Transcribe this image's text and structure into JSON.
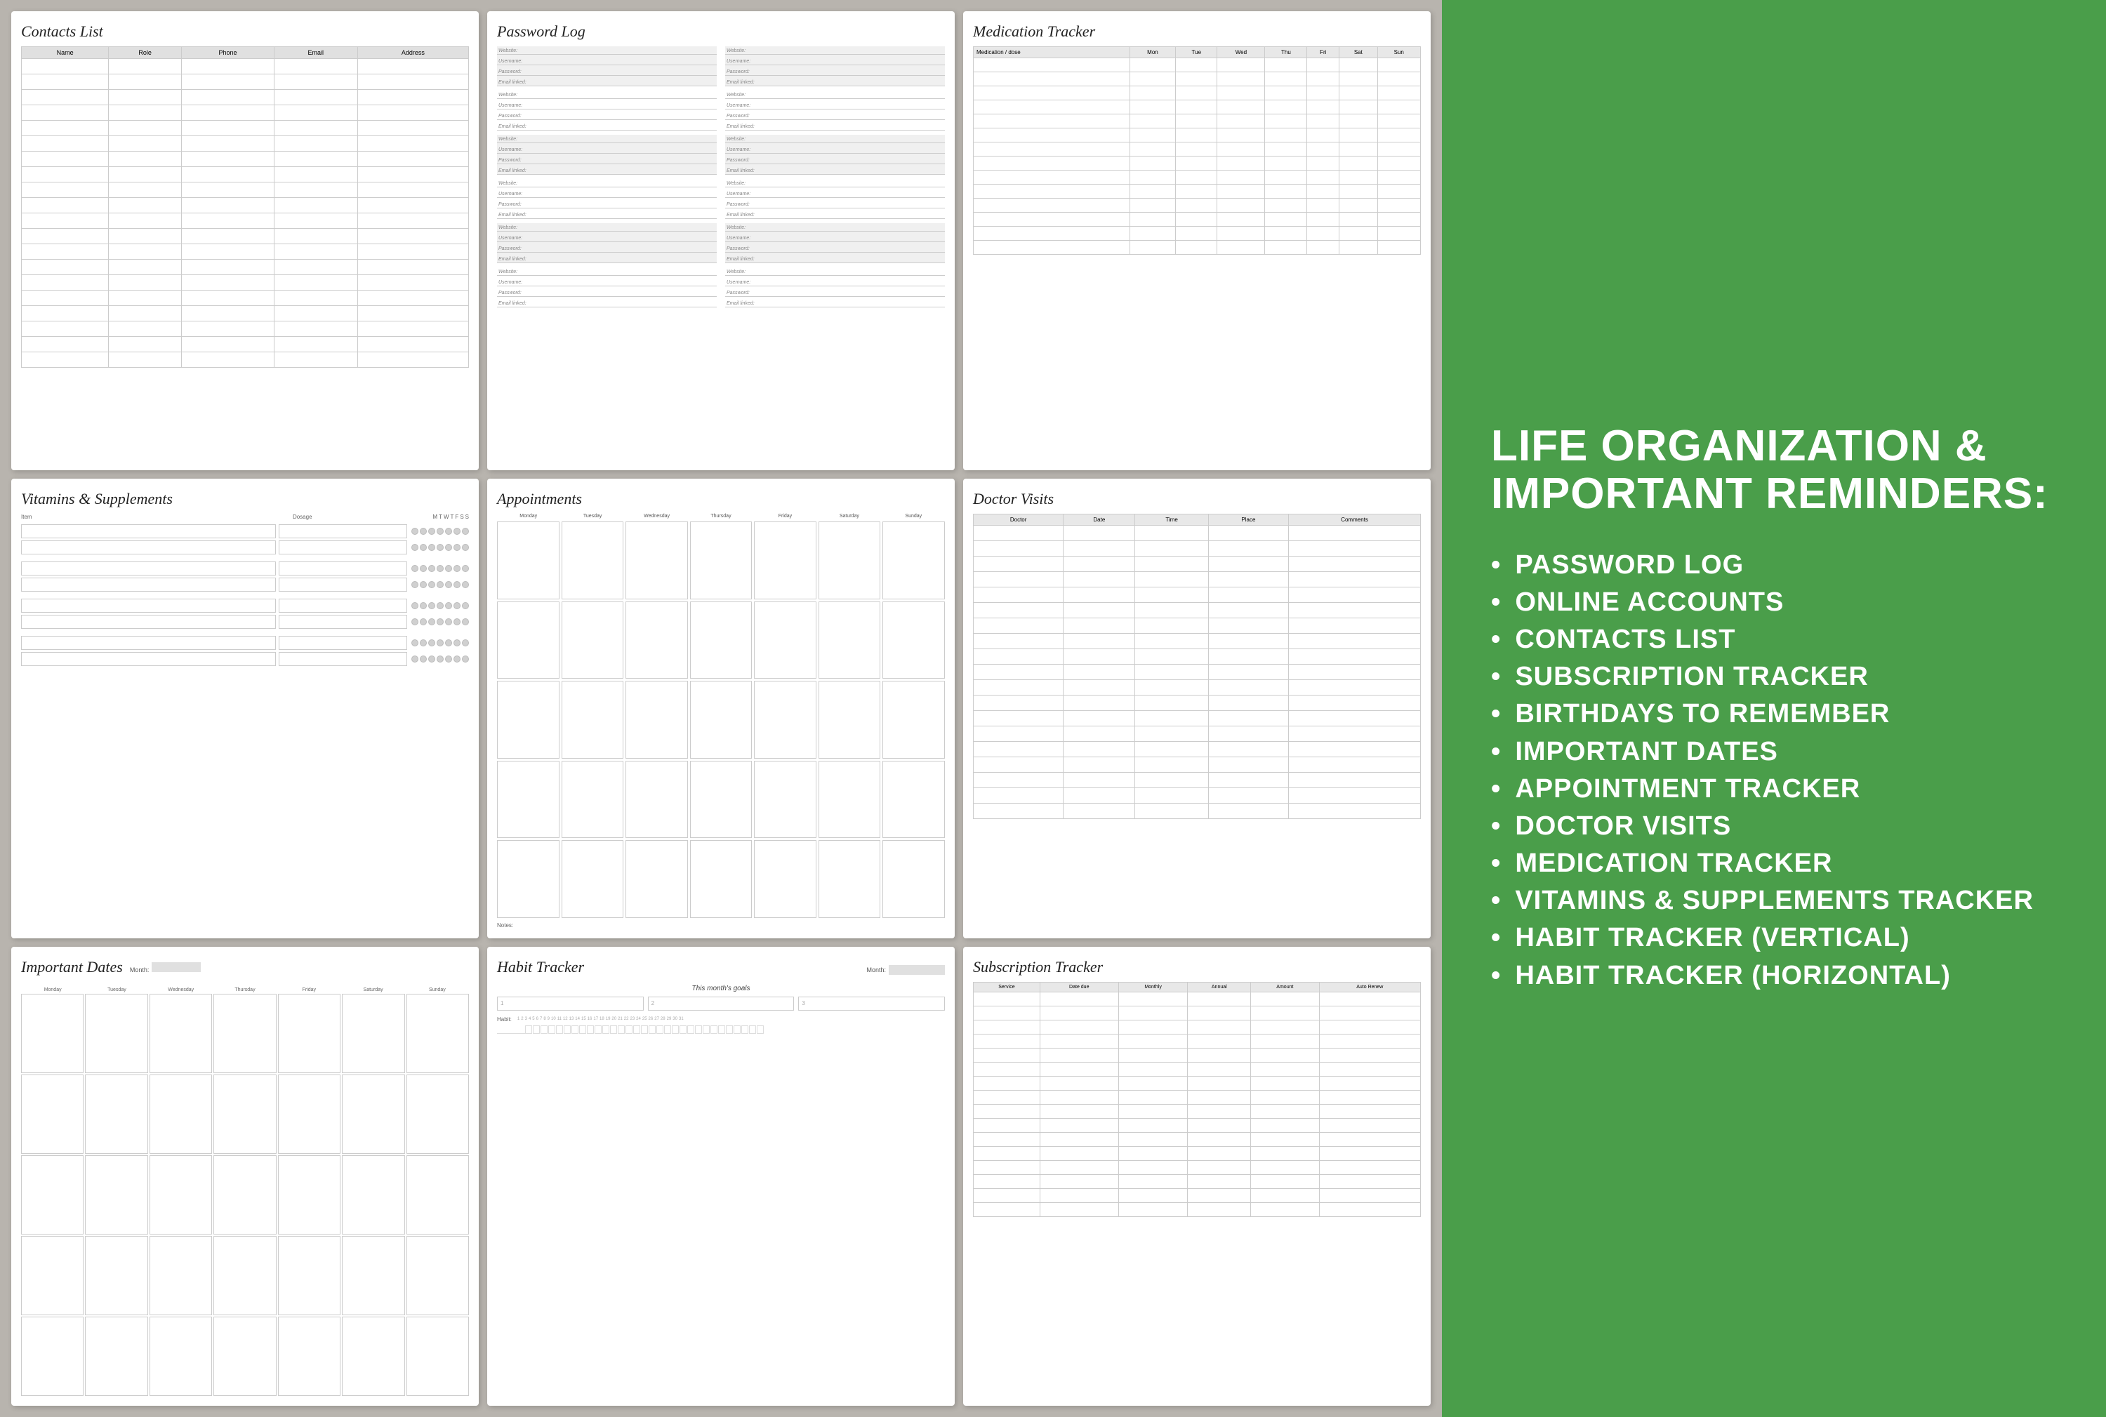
{
  "rightPanel": {
    "title": "LIFE ORGANIZATION &\nIMPORTANT REMINDERS:",
    "items": [
      "PASSWORD LOG",
      "ONLINE ACCOUNTS",
      "CONTACTS LIST",
      "SUBSCRIPTION TRACKER",
      "BIRTHDAYS TO REMEMBER",
      "IMPORTANT DATES",
      "APPOINTMENT TRACKER",
      "DOCTOR VISITS",
      "MEDICATION TRACKER",
      "VITAMINS & SUPPLEMENTS TRACKER",
      "HABIT TRACKER (VERTICAL)",
      "HABIT TRACKER (HORIZONTAL)"
    ]
  },
  "cards": {
    "contacts": {
      "title": "Contacts List",
      "columns": [
        "Name",
        "Role",
        "Phone",
        "Email",
        "Address"
      ]
    },
    "password": {
      "title": "Password Log",
      "fields": [
        "Website:",
        "Username:",
        "Password:",
        "Email linked:"
      ]
    },
    "medication": {
      "title": "Medication Tracker",
      "columns": [
        "Medication / dose",
        "Mon",
        "Tue",
        "Wed",
        "Thu",
        "Fri",
        "Sat",
        "Sun"
      ]
    },
    "vitamins": {
      "title": "Vitamins & Supplements",
      "columns": [
        "Item",
        "Dosage",
        "M",
        "T",
        "W",
        "T",
        "S",
        "S"
      ]
    },
    "appointments": {
      "title": "Appointments",
      "days": [
        "Monday",
        "Tuesday",
        "Wednesday",
        "Thursday",
        "Friday",
        "Saturday",
        "Sunday"
      ],
      "notes": "Notes:"
    },
    "doctor": {
      "title": "Doctor Visits",
      "columns": [
        "Doctor",
        "Date",
        "Time",
        "Place",
        "Comments"
      ]
    },
    "important": {
      "title": "Important Dates",
      "days": [
        "Monday",
        "Tuesday",
        "Wednesday",
        "Thursday",
        "Friday",
        "Saturday",
        "Sunday"
      ],
      "month": "Month:"
    },
    "habit": {
      "title": "Habit Tracker",
      "month": "Month:",
      "goalsTitle": "This month's goals",
      "goalNums": [
        "1",
        "2",
        "3"
      ],
      "habitLabel": "Habit:"
    },
    "subscription": {
      "title": "Subscription Tracker",
      "columns": [
        "Service",
        "Date due",
        "Monthly",
        "Annual",
        "Amount",
        "Auto Renew"
      ]
    }
  }
}
